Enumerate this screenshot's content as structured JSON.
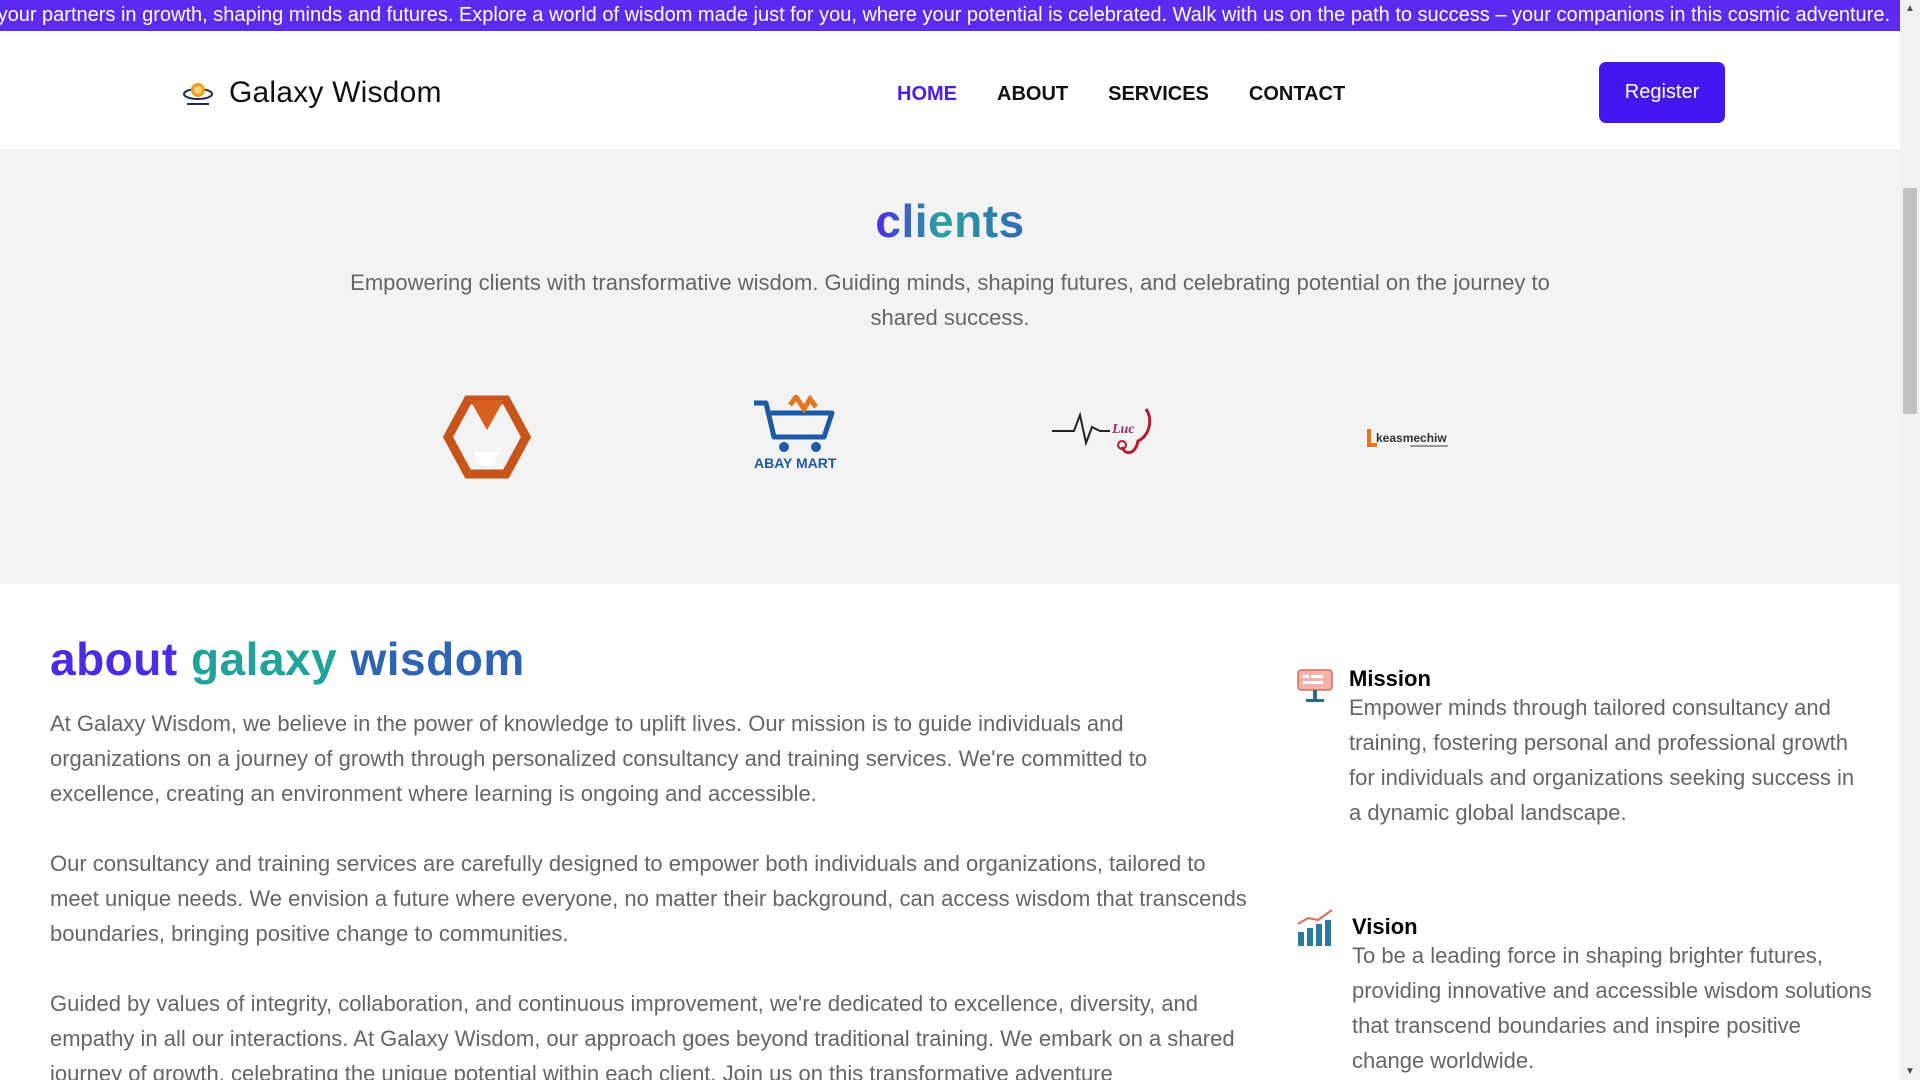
{
  "ticker": {
    "text": "your partners in growth, shaping minds and futures. Explore a world of wisdom made just for you, where your potential is celebrated. Walk with us on the path to success – your companions in this cosmic adventure."
  },
  "header": {
    "logo_icon": "galaxy-wisdom-logo",
    "brand": "Galaxy Wisdom",
    "nav": [
      {
        "label": "HOME",
        "active": true
      },
      {
        "label": "ABOUT",
        "active": false
      },
      {
        "label": "SERVICES",
        "active": false
      },
      {
        "label": "CONTACT",
        "active": false
      }
    ],
    "register_label": "Register"
  },
  "clients": {
    "title": "clients",
    "subtitle": "Empowering clients with transformative wisdom. Guiding minds, shaping futures, and celebrating potential on the journey to shared success.",
    "logos": [
      {
        "icon": "orange-hexagon-logo",
        "text": ""
      },
      {
        "icon": "abay-mart-cart-logo",
        "text": "ABAY MART"
      },
      {
        "icon": "stethoscope-heartbeat-logo",
        "text": "Luc"
      },
      {
        "icon": "keasmechiw-logo",
        "text": "keasmechiw"
      }
    ]
  },
  "about": {
    "title_words": [
      "about",
      "galaxy",
      "wisdom"
    ],
    "paragraphs": [
      "At Galaxy Wisdom, we believe in the power of knowledge to uplift lives. Our mission is to guide individuals and organizations on a journey of growth through personalized consultancy and training services. We're committed to excellence, creating an environment where learning is ongoing and accessible.",
      "Our consultancy and training services are carefully designed to empower both individuals and organizations, tailored to meet unique needs. We envision a future where everyone, no matter their background, can access wisdom that transcends boundaries, bringing positive change to communities.",
      "Guided by values of integrity, collaboration, and continuous improvement, we're dedicated to excellence, diversity, and empathy in all our interactions. At Galaxy Wisdom, our approach goes beyond traditional training. We embark on a shared journey of growth, celebrating the unique potential within each client. Join us on this transformative adventure"
    ],
    "mission": {
      "icon": "presentation-board-icon",
      "title": "Mission",
      "text": "Empower minds through tailored consultancy and training, fostering personal and professional growth for individuals and organizations seeking success in a dynamic global landscape."
    },
    "vision": {
      "icon": "bar-chart-growth-icon",
      "title": "Vision",
      "text": "To be a leading force in shaping brighter futures, providing innovative and accessible wisdom solutions that transcend boundaries and inspire positive change worldwide."
    }
  },
  "colors": {
    "accent": "#4318f0",
    "ticker_bg": "#5b2bf2",
    "section_bg": "#f3f3f3",
    "body_text": "#666666"
  }
}
